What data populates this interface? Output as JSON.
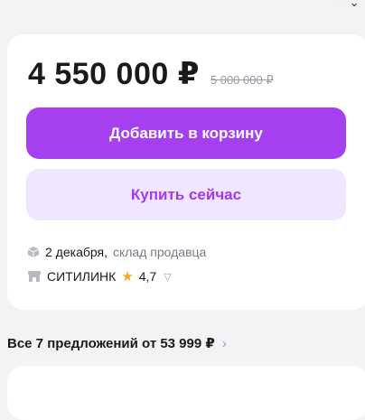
{
  "product": {
    "price": "4 550 000 ₽",
    "old_price": "5 000 000 ₽",
    "add_to_cart_label": "Добавить в корзину",
    "buy_now_label": "Купить сейчас"
  },
  "delivery": {
    "date": "2 декабря,",
    "source": "склад продавца",
    "icon": "box-icon"
  },
  "seller": {
    "name": "СИТИЛИНК",
    "rating": "4,7",
    "icon": "shop-icon"
  },
  "offers": {
    "label": "Все 7 предложений от 53 999 ₽"
  },
  "colors": {
    "accent": "#a53ff0",
    "accent_light": "#f1e6ff",
    "star": "#f5a623"
  }
}
